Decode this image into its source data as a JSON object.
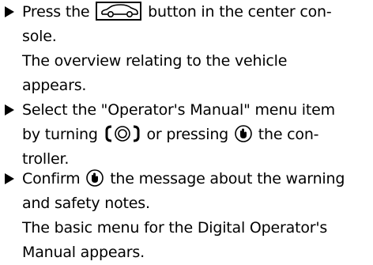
{
  "steps": [
    {
      "lines": [
        "Press the",
        "button in the center con-",
        "sole."
      ],
      "result": [
        "The overview relating to the vehicle",
        "appears."
      ]
    },
    {
      "lines": [
        "Select the \"Operator's Manual\" menu item",
        "by turning",
        "or pressing",
        "the con-",
        "troller."
      ]
    },
    {
      "lines": [
        "Confirm",
        "the message about the warning",
        "and safety notes."
      ],
      "result": [
        "The basic menu for the Digital Operator's",
        "Manual appears."
      ]
    }
  ],
  "icons": {
    "vehicle_button": "car-icon",
    "turn_controller": "turn-controller-icon",
    "press_controller": "press-controller-icon"
  }
}
